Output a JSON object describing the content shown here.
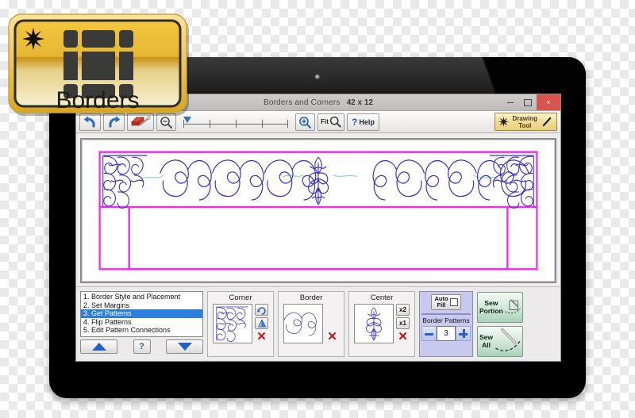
{
  "badge": {
    "label": "Borders",
    "icon": "borders-grid-icon",
    "star_icon": "starburst-icon",
    "gold_light": "#f7e08a",
    "gold_dark": "#d9a521"
  },
  "window": {
    "title": "Borders and Corners",
    "dimensions": "42 x 12",
    "controls": {
      "minimize": "minimize-icon",
      "maximize": "maximize-icon",
      "close": "×"
    }
  },
  "toolbar": {
    "undo_icon": "undo-arrow-icon",
    "redo_icon": "redo-arrow-icon",
    "eraser_icon": "eraser-icon",
    "zoom_out_icon": "zoom-out-icon",
    "zoom_in_icon": "zoom-in-icon",
    "fit_label": "Fit",
    "fit_icon": "fit-magnifier-icon",
    "help_mark": "?",
    "help_label": "Help",
    "drawing_tool_line1": "Drawing",
    "drawing_tool_line2": "Tool",
    "drawing_tool_star_icon": "starburst-icon",
    "drawing_tool_pen_icon": "pencil-icon",
    "slider_ticks": 5
  },
  "steps": {
    "items": [
      "1. Border Style and Placement",
      "2. Set Margins",
      "3. Get Patterns",
      "4. Flip Patterns",
      "5. Edit Pattern Connections"
    ],
    "selected_index": 2,
    "selected_color": "#2b7fdd",
    "nav": {
      "up_icon": "triangle-up-icon",
      "help_label": "?",
      "down_icon": "triangle-down-icon"
    }
  },
  "panels": {
    "corner": {
      "title": "Corner",
      "thumb_icon": "corner-feather-pattern",
      "buttons": [
        {
          "name": "rotate-button",
          "label": "",
          "icon": "rotate-icon"
        },
        {
          "name": "flip-button",
          "label": "",
          "icon": "flip-icon"
        },
        {
          "name": "delete-button",
          "label": "✕",
          "icon": "red-x-icon"
        }
      ]
    },
    "border": {
      "title": "Border",
      "thumb_icon": "border-meander-pattern",
      "buttons": [
        {
          "name": "delete-button",
          "label": "✕",
          "icon": "red-x-icon"
        }
      ]
    },
    "center": {
      "title": "Center",
      "thumb_icon": "center-medallion-pattern",
      "buttons": [
        {
          "name": "x2-button",
          "label": "x2",
          "icon": ""
        },
        {
          "name": "x1-button",
          "label": "x1",
          "icon": ""
        },
        {
          "name": "delete-button",
          "label": "✕",
          "icon": "red-x-icon"
        }
      ]
    },
    "autofill": {
      "button_line1": "Auto",
      "button_line2": "Fill",
      "checkbox_checked": false,
      "border_patterns_label": "Border Patterns",
      "border_patterns_value": "3",
      "minus_label": "−",
      "plus_label": "+",
      "bg_color": "#c9c8ee"
    }
  },
  "sew": {
    "portion_line1": "Sew",
    "portion_line2": "Portion",
    "all_line1": "Sew",
    "all_line2": "All",
    "icon": "needle-icon",
    "accent": "#a9d2ba"
  },
  "canvas": {
    "border_color": "#ee30ee",
    "pattern_color": "#3b34c8",
    "connector_color": "#8fd3e8",
    "corner_pattern": "feather-corner",
    "border_pattern": "meander-wave",
    "center_pattern": "center-medallion",
    "border_repeats": 3
  }
}
